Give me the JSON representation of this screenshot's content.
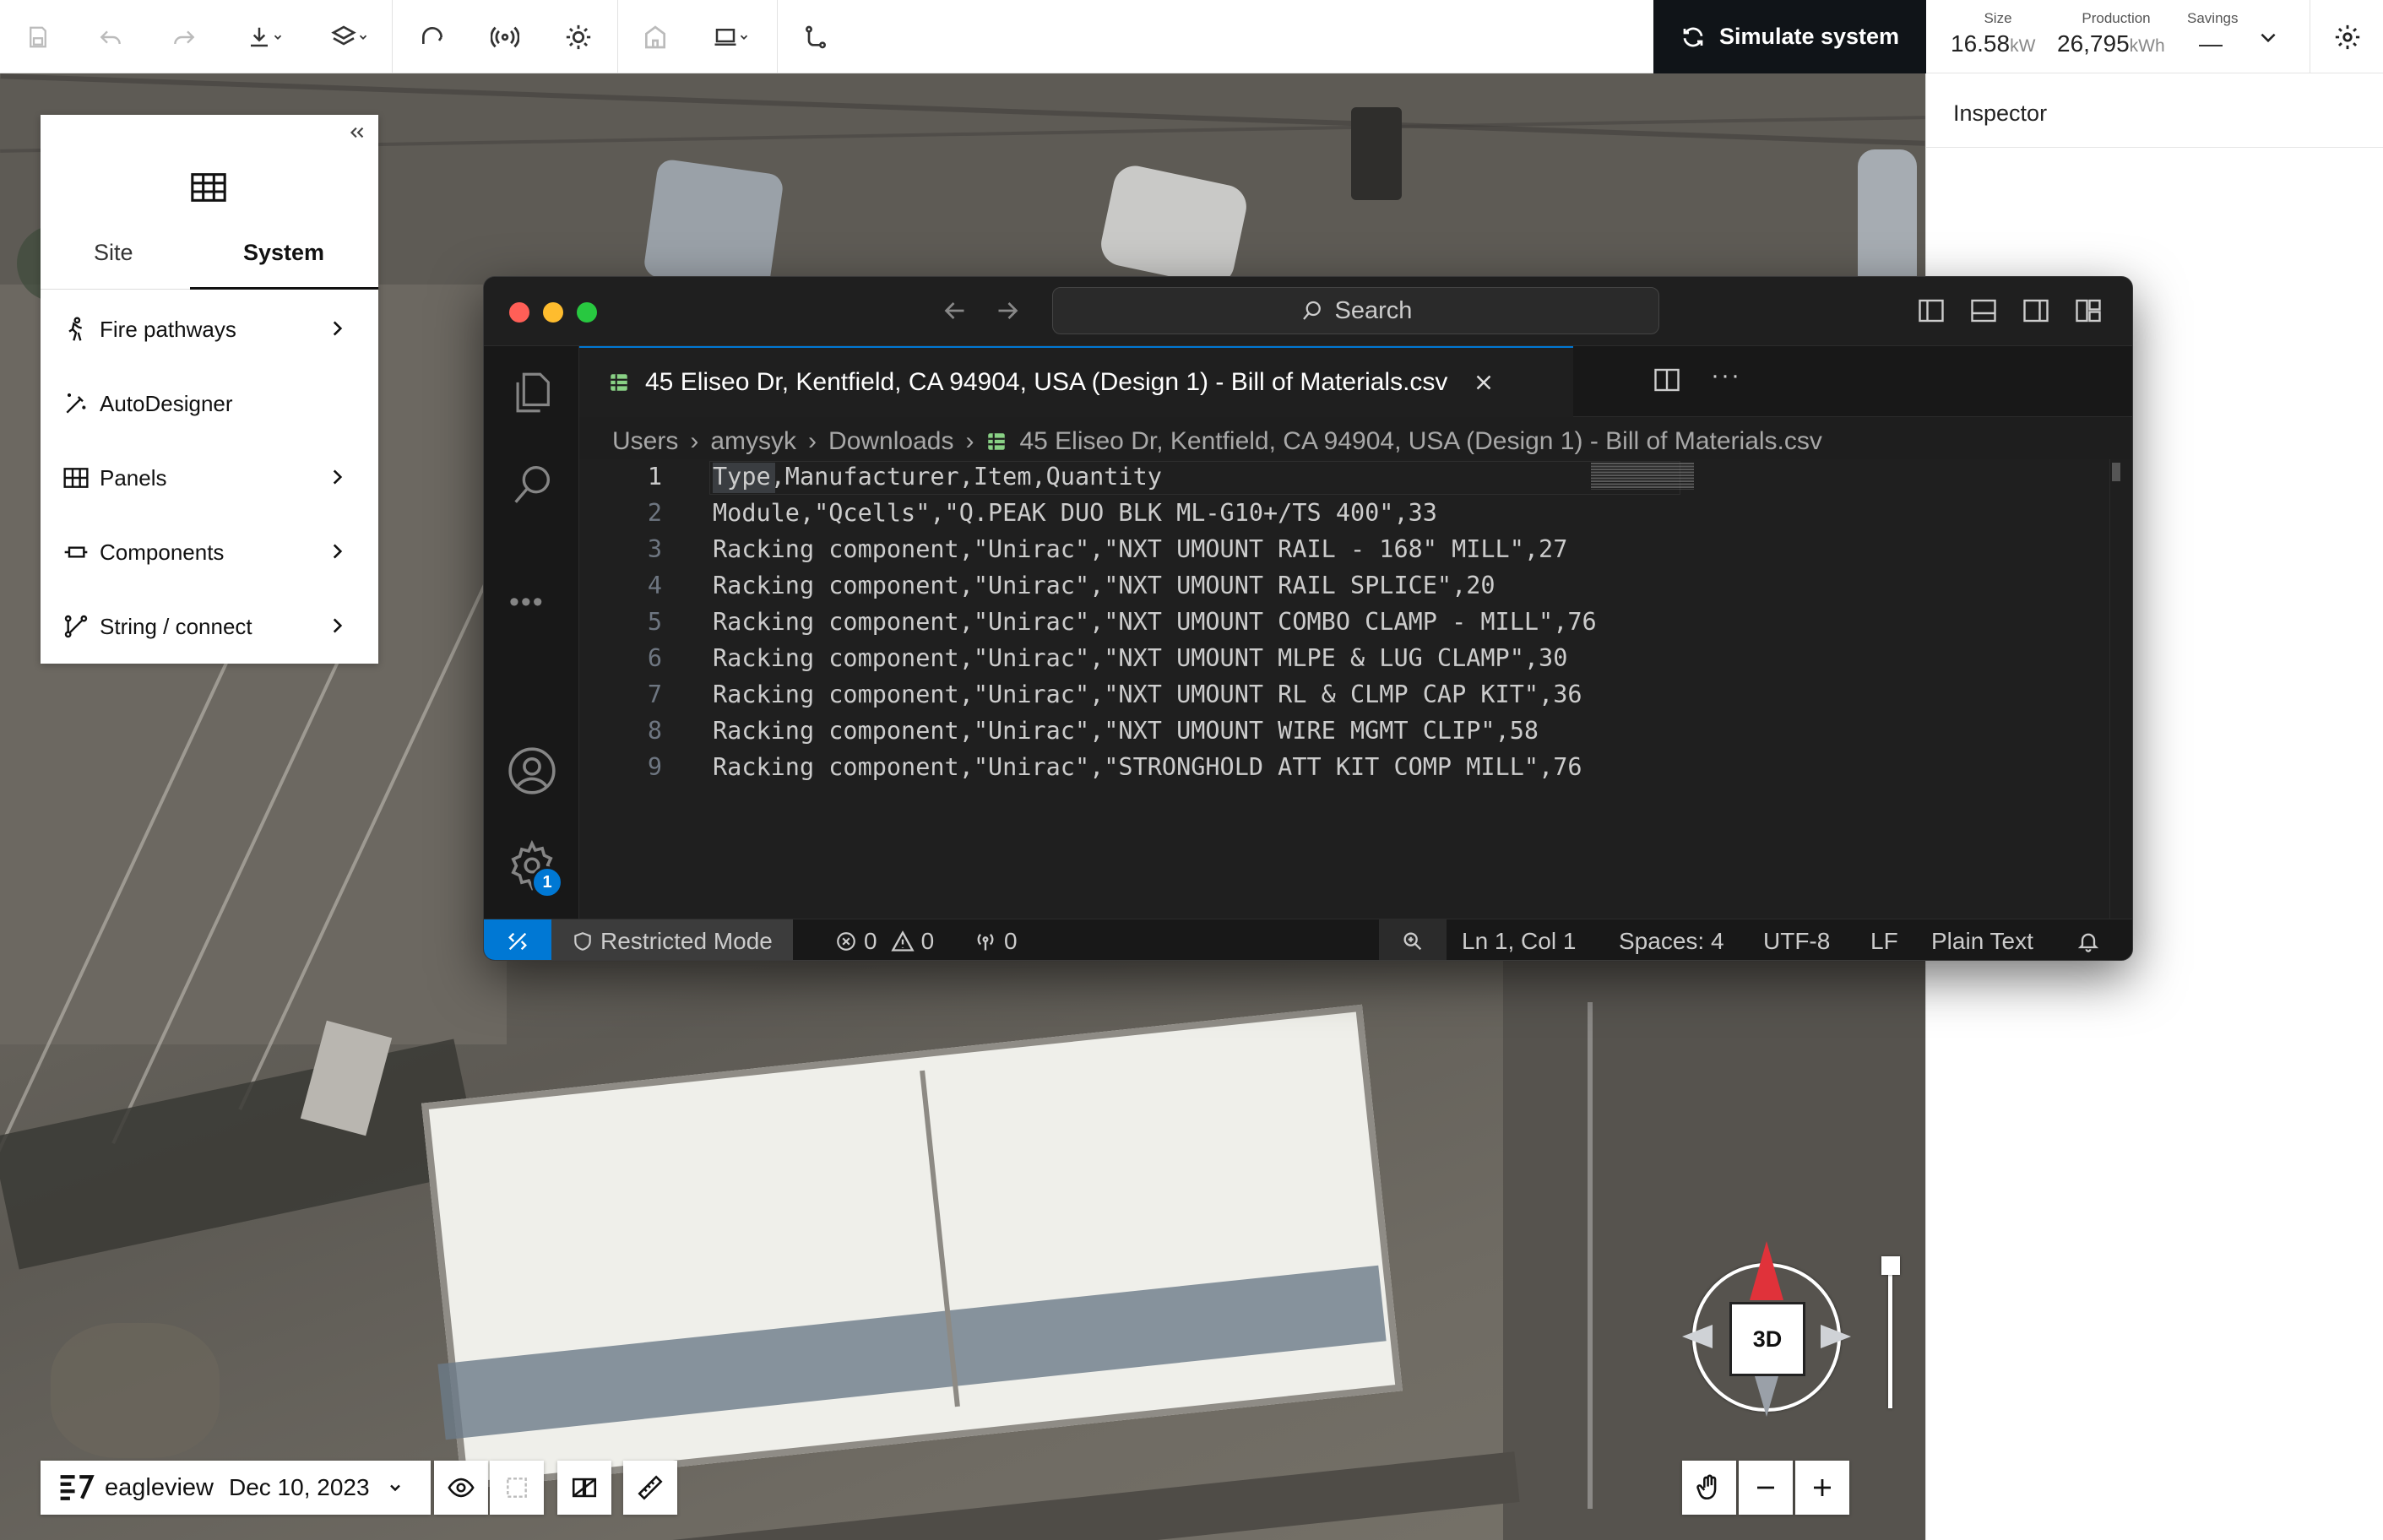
{
  "toolbar": {
    "simulate_label": "Simulate system",
    "stats": {
      "size_label": "Size",
      "size_value": "16.58",
      "size_unit": "kW",
      "production_label": "Production",
      "production_value": "26,795",
      "production_unit": "kWh",
      "savings_label": "Savings",
      "savings_value": "—"
    }
  },
  "inspector": {
    "title": "Inspector"
  },
  "left_panel": {
    "tabs": [
      "Site",
      "System"
    ],
    "active_tab": "System",
    "items": [
      {
        "label": "Fire pathways",
        "icon": "person-walking-icon",
        "has_chevron": true
      },
      {
        "label": "AutoDesigner",
        "icon": "magic-wand-icon",
        "has_chevron": false
      },
      {
        "label": "Panels",
        "icon": "panels-grid-icon",
        "has_chevron": true
      },
      {
        "label": "Components",
        "icon": "component-icon",
        "has_chevron": true
      },
      {
        "label": "String / connect",
        "icon": "string-connect-icon",
        "has_chevron": true
      }
    ]
  },
  "vscode": {
    "search_label": "Search",
    "tab_label": "45 Eliseo Dr, Kentfield, CA 94904, USA (Design 1) - Bill of Materials.csv",
    "breadcrumbs": [
      "Users",
      "amysyk",
      "Downloads",
      "45 Eliseo Dr, Kentfield, CA 94904, USA (Design 1) - Bill of Materials.csv"
    ],
    "settings_badge": "1",
    "lines": [
      {
        "n": "1",
        "text": "Type,Manufacturer,Item,Quantity"
      },
      {
        "n": "2",
        "text": "Module,\"Qcells\",\"Q.PEAK DUO BLK ML-G10+/TS 400\",33"
      },
      {
        "n": "3",
        "text": "Racking component,\"Unirac\",\"NXT UMOUNT RAIL - 168\" MILL\",27"
      },
      {
        "n": "4",
        "text": "Racking component,\"Unirac\",\"NXT UMOUNT RAIL SPLICE\",20"
      },
      {
        "n": "5",
        "text": "Racking component,\"Unirac\",\"NXT UMOUNT COMBO CLAMP - MILL\",76"
      },
      {
        "n": "6",
        "text": "Racking component,\"Unirac\",\"NXT UMOUNT MLPE & LUG CLAMP\",30"
      },
      {
        "n": "7",
        "text": "Racking component,\"Unirac\",\"NXT UMOUNT RL & CLMP CAP KIT\",36"
      },
      {
        "n": "8",
        "text": "Racking component,\"Unirac\",\"NXT UMOUNT WIRE MGMT CLIP\",58"
      },
      {
        "n": "9",
        "text": "Racking component,\"Unirac\",\"STRONGHOLD ATT KIT COMP MILL\",76"
      }
    ],
    "status": {
      "restricted": "Restricted Mode",
      "errors": "0",
      "warnings": "0",
      "ports": "0",
      "position": "Ln 1, Col 1",
      "spaces": "Spaces: 4",
      "encoding": "UTF-8",
      "eol": "LF",
      "language": "Plain Text"
    }
  },
  "map": {
    "provider": "eagleview",
    "date": "Dec 10, 2023",
    "compass_label": "3D"
  }
}
